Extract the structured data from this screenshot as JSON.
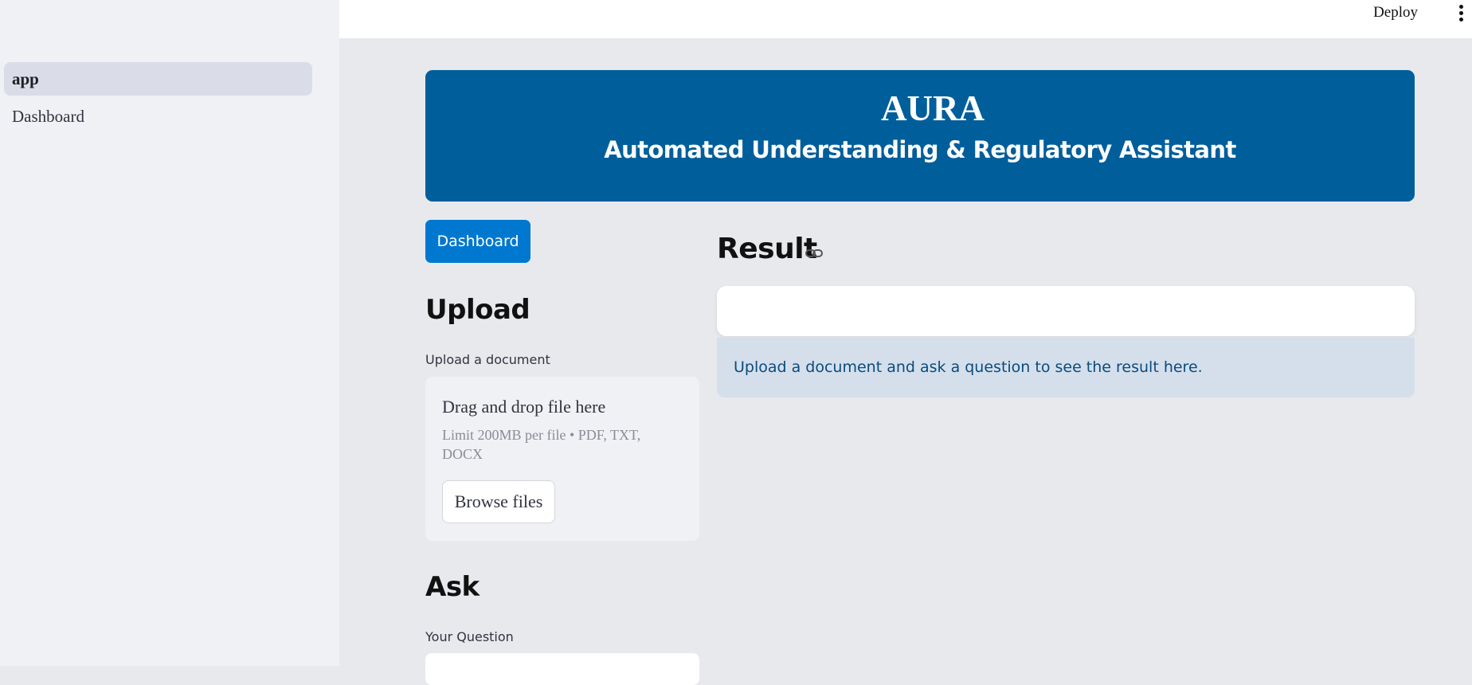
{
  "sidebar": {
    "items": [
      {
        "label": "app",
        "active": true
      },
      {
        "label": "Dashboard",
        "active": false
      }
    ]
  },
  "topbar": {
    "deploy_label": "Deploy",
    "menu_icon": "vertical-dots-icon"
  },
  "banner": {
    "title": "AURA",
    "subtitle": "Automated Understanding & Regulatory Assistant",
    "background": "#005e9b"
  },
  "main": {
    "dashboard_button": "Dashboard",
    "upload": {
      "heading": "Upload",
      "field_label": "Upload a document",
      "drop_title": "Drag and drop file here",
      "limit_text": "Limit 200MB per file • PDF, TXT, DOCX",
      "browse_label": "Browse files"
    },
    "ask": {
      "heading": "Ask",
      "field_label": "Your Question",
      "value": ""
    },
    "result": {
      "heading": "Result",
      "link_icon": "link-icon",
      "info_text": "Upload a document and ask a question to see the result here."
    }
  },
  "colors": {
    "accent": "#0078cf",
    "info_background": "#d4dfeb",
    "info_text": "#0a4b7e"
  }
}
